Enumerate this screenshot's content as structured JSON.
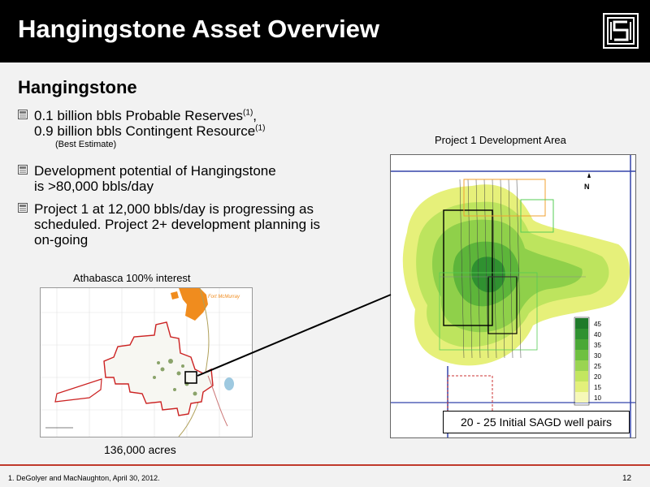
{
  "header": {
    "title": "Hangingstone Asset Overview"
  },
  "subtitle": "Hangingstone",
  "bullets": [
    {
      "line1": "0.1 billion bbls Probable Reserves",
      "sup1": "(1)",
      "line1_end": ",",
      "line2": "0.9 billion bbls Contingent Resource",
      "sup2": "(1)",
      "note": "(Best Estimate)"
    },
    {
      "line1": "Development potential of Hangingstone",
      "line2": "is >80,000 bbls/day"
    },
    {
      "line1": "Project 1 at 12,000 bbls/day is progressing as",
      "line2": "scheduled. Project 2+ development planning is",
      "line3": "on-going"
    }
  ],
  "left_map": {
    "caption": "Athabasca 100% interest",
    "place_label": "Fort McMurray",
    "acres": "136,000 acres"
  },
  "right_map": {
    "caption": "Project 1 Development Area",
    "north": "N",
    "legend_values": [
      "45",
      "40",
      "35",
      "30",
      "25",
      "20",
      "15",
      "10"
    ],
    "sagd_label": "20 - 25 Initial SAGD well pairs"
  },
  "footer": {
    "note": "1.  DeGolyer and MacNaughton, April 30, 2012.",
    "page": "12"
  },
  "colors": {
    "header_bg": "#000000",
    "footer_rule": "#c0392b",
    "reserve_outline": "#cc2222",
    "city_fill": "#f08c1e"
  }
}
